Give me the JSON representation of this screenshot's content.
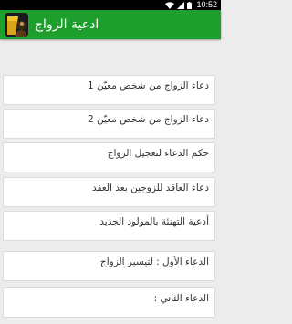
{
  "status_bar": {
    "time": "10:52",
    "icons": [
      "wifi-icon",
      "cell-signal-icon",
      "battery-icon"
    ]
  },
  "app_bar": {
    "title": "ادعية الزواج",
    "icon": "app-logo-icon",
    "color": "#1e9e2c"
  },
  "items": [
    {
      "label": "دعاء الزواج من شخص معيّن 1"
    },
    {
      "label": "دعاء الزواج من شخص معيّن 2"
    },
    {
      "label": "حكم الدعاء لتعجيل الزواج"
    },
    {
      "label": "دعاء العاقد للزوجين بعد العقد"
    },
    {
      "label": "أدعية التهنئة بالمولود الجديد"
    },
    {
      "label": "الدعاء الأول : لتيسير الزواج"
    },
    {
      "label": "الدعاء الثاني :"
    }
  ]
}
